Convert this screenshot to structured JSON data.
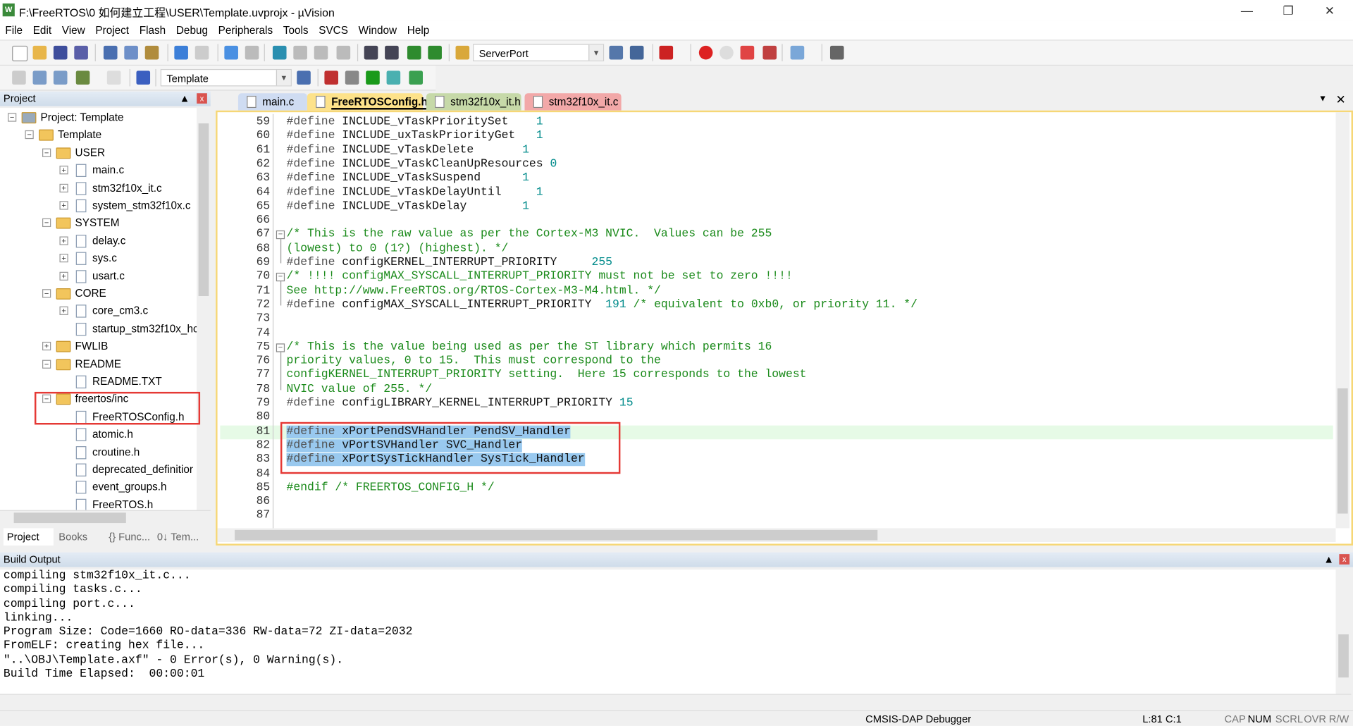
{
  "window": {
    "title": "F:\\FreeRTOS\\0 如何建立工程\\USER\\Template.uvprojx - µVision",
    "icon": "uvision-icon",
    "controls": [
      "minimize",
      "restore",
      "close"
    ]
  },
  "menu": [
    "File",
    "Edit",
    "View",
    "Project",
    "Flash",
    "Debug",
    "Peripherals",
    "Tools",
    "SVCS",
    "Window",
    "Help"
  ],
  "toolbar": {
    "search_combo": "ServerPort",
    "target_combo": "Template"
  },
  "project_panel": {
    "title": "Project",
    "tree": [
      {
        "label": "Project: Template",
        "level": 0,
        "type": "root",
        "exp": "-"
      },
      {
        "label": "Template",
        "level": 1,
        "type": "target",
        "exp": "-"
      },
      {
        "label": "USER",
        "level": 2,
        "type": "folder",
        "exp": "-"
      },
      {
        "label": "main.c",
        "level": 3,
        "type": "file",
        "exp": "+"
      },
      {
        "label": "stm32f10x_it.c",
        "level": 3,
        "type": "file",
        "exp": "+"
      },
      {
        "label": "system_stm32f10x.c",
        "level": 3,
        "type": "file",
        "exp": "+"
      },
      {
        "label": "SYSTEM",
        "level": 2,
        "type": "folder",
        "exp": "-"
      },
      {
        "label": "delay.c",
        "level": 3,
        "type": "file",
        "exp": "+"
      },
      {
        "label": "sys.c",
        "level": 3,
        "type": "file",
        "exp": "+"
      },
      {
        "label": "usart.c",
        "level": 3,
        "type": "file",
        "exp": "+"
      },
      {
        "label": "CORE",
        "level": 2,
        "type": "folder",
        "exp": "-"
      },
      {
        "label": "core_cm3.c",
        "level": 3,
        "type": "file",
        "exp": "+"
      },
      {
        "label": "startup_stm32f10x_hc",
        "level": 3,
        "type": "file",
        "exp": ""
      },
      {
        "label": "FWLIB",
        "level": 2,
        "type": "folder",
        "exp": "+"
      },
      {
        "label": "README",
        "level": 2,
        "type": "folder",
        "exp": "-"
      },
      {
        "label": "README.TXT",
        "level": 3,
        "type": "file",
        "exp": ""
      },
      {
        "label": "freertos/inc",
        "level": 2,
        "type": "folder",
        "exp": "-"
      },
      {
        "label": "FreeRTOSConfig.h",
        "level": 3,
        "type": "file",
        "exp": ""
      },
      {
        "label": "atomic.h",
        "level": 3,
        "type": "file",
        "exp": ""
      },
      {
        "label": "croutine.h",
        "level": 3,
        "type": "file",
        "exp": ""
      },
      {
        "label": "deprecated_definitior",
        "level": 3,
        "type": "file",
        "exp": ""
      },
      {
        "label": "event_groups.h",
        "level": 3,
        "type": "file",
        "exp": ""
      },
      {
        "label": "FreeRTOS.h",
        "level": 3,
        "type": "file",
        "exp": ""
      }
    ],
    "tabs": [
      "Project",
      "Books",
      "{} Func...",
      "0↓ Tem..."
    ]
  },
  "editor": {
    "tabs": [
      {
        "label": "main.c",
        "color": "#cfdcf2",
        "active": false
      },
      {
        "label": "FreeRTOSConfig.h",
        "color": "#fde28a",
        "active": true
      },
      {
        "label": "stm32f10x_it.h",
        "color": "#c6d9a8",
        "active": false
      },
      {
        "label": "stm32f10x_it.c",
        "color": "#f2a8a8",
        "active": false
      }
    ],
    "current_line": 81,
    "lines": [
      {
        "n": "59",
        "s": [
          [
            "kw",
            "#define "
          ],
          [
            "nm",
            "INCLUDE_vTaskPrioritySet    "
          ],
          [
            "nu",
            "1"
          ]
        ]
      },
      {
        "n": "60",
        "s": [
          [
            "kw",
            "#define "
          ],
          [
            "nm",
            "INCLUDE_uxTaskPriorityGet   "
          ],
          [
            "nu",
            "1"
          ]
        ]
      },
      {
        "n": "61",
        "s": [
          [
            "kw",
            "#define "
          ],
          [
            "nm",
            "INCLUDE_vTaskDelete       "
          ],
          [
            "nu",
            "1"
          ]
        ]
      },
      {
        "n": "62",
        "s": [
          [
            "kw",
            "#define "
          ],
          [
            "nm",
            "INCLUDE_vTaskCleanUpResources "
          ],
          [
            "nu",
            "0"
          ]
        ]
      },
      {
        "n": "63",
        "s": [
          [
            "kw",
            "#define "
          ],
          [
            "nm",
            "INCLUDE_vTaskSuspend      "
          ],
          [
            "nu",
            "1"
          ]
        ]
      },
      {
        "n": "64",
        "s": [
          [
            "kw",
            "#define "
          ],
          [
            "nm",
            "INCLUDE_vTaskDelayUntil     "
          ],
          [
            "nu",
            "1"
          ]
        ]
      },
      {
        "n": "65",
        "s": [
          [
            "kw",
            "#define "
          ],
          [
            "nm",
            "INCLUDE_vTaskDelay        "
          ],
          [
            "nu",
            "1"
          ]
        ]
      },
      {
        "n": "66",
        "s": []
      },
      {
        "n": "67",
        "fold": "-",
        "s": [
          [
            "cm",
            "/* This is the raw value as per the Cortex-M3 NVIC.  Values can be 255"
          ]
        ]
      },
      {
        "n": "68",
        "s": [
          [
            "cm",
            "(lowest) to 0 (1?) (highest). */"
          ]
        ]
      },
      {
        "n": "69",
        "s": [
          [
            "kw",
            "#define "
          ],
          [
            "nm",
            "configKERNEL_INTERRUPT_PRIORITY     "
          ],
          [
            "nu",
            "255"
          ]
        ]
      },
      {
        "n": "70",
        "fold": "-",
        "s": [
          [
            "cm",
            "/* !!!! configMAX_SYSCALL_INTERRUPT_PRIORITY must not be set to zero !!!!"
          ]
        ]
      },
      {
        "n": "71",
        "s": [
          [
            "cm",
            "See http://www.FreeRTOS.org/RTOS-Cortex-M3-M4.html. */"
          ]
        ]
      },
      {
        "n": "72",
        "s": [
          [
            "kw",
            "#define "
          ],
          [
            "nm",
            "configMAX_SYSCALL_INTERRUPT_PRIORITY  "
          ],
          [
            "nu",
            "191 "
          ],
          [
            "cm",
            "/* equivalent to 0xb0, or priority 11. */"
          ]
        ]
      },
      {
        "n": "73",
        "s": []
      },
      {
        "n": "74",
        "s": []
      },
      {
        "n": "75",
        "fold": "-",
        "s": [
          [
            "cm",
            "/* This is the value being used as per the ST library which permits 16"
          ]
        ]
      },
      {
        "n": "76",
        "s": [
          [
            "cm",
            "priority values, 0 to 15.  This must correspond to the"
          ]
        ]
      },
      {
        "n": "77",
        "s": [
          [
            "cm",
            "configKERNEL_INTERRUPT_PRIORITY setting.  Here 15 corresponds to the lowest"
          ]
        ]
      },
      {
        "n": "78",
        "s": [
          [
            "cm",
            "NVIC value of 255. */"
          ]
        ]
      },
      {
        "n": "79",
        "s": [
          [
            "kw",
            "#define "
          ],
          [
            "nm",
            "configLIBRARY_KERNEL_INTERRUPT_PRIORITY "
          ],
          [
            "nu",
            "15"
          ]
        ]
      },
      {
        "n": "80",
        "s": []
      },
      {
        "n": "81",
        "sel": true,
        "s": [
          [
            "kw",
            "#define "
          ],
          [
            "nm",
            "xPortPendSVHandler PendSV_Handler"
          ]
        ]
      },
      {
        "n": "82",
        "sel": true,
        "s": [
          [
            "kw",
            "#define "
          ],
          [
            "nm",
            "vPortSVHandler SVC_Handler"
          ]
        ]
      },
      {
        "n": "83",
        "sel": true,
        "s": [
          [
            "kw",
            "#define "
          ],
          [
            "nm",
            "xPortSysTickHandler SysTick_Handler"
          ]
        ]
      },
      {
        "n": "84",
        "s": []
      },
      {
        "n": "85",
        "s": [
          [
            "cm",
            "#endif /* FREERTOS_CONFIG_H */"
          ]
        ]
      },
      {
        "n": "86",
        "s": []
      },
      {
        "n": "87",
        "s": []
      }
    ]
  },
  "build_output": {
    "title": "Build Output",
    "lines": [
      "compiling stm32f10x_it.c...",
      "compiling tasks.c...",
      "compiling port.c...",
      "linking...",
      "Program Size: Code=1660 RO-data=336 RW-data=72 ZI-data=2032",
      "FromELF: creating hex file...",
      "\"..\\OBJ\\Template.axf\" - 0 Error(s), 0 Warning(s).",
      "Build Time Elapsed:  00:00:01"
    ]
  },
  "status": {
    "debugger": "CMSIS-DAP Debugger",
    "position": "L:81 C:1",
    "cap": "CAP",
    "num": "NUM",
    "scrl": "SCRL",
    "ovr": "OVR",
    "rw": "R/W"
  },
  "colors": {
    "selection": "#99c9ef",
    "current_line": "#e6fae6",
    "annotation_box": "#e53935",
    "editor_border": "#f6d776"
  }
}
